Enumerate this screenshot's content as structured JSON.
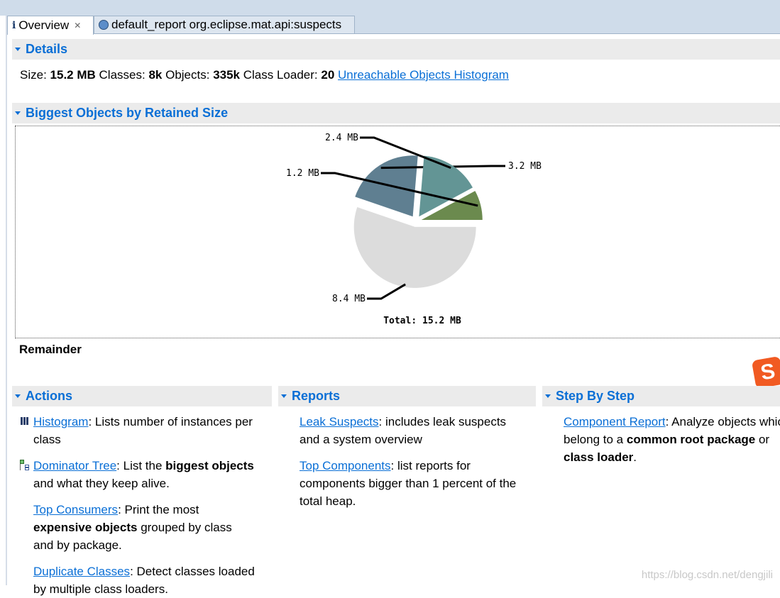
{
  "tabs": [
    {
      "label": "Overview",
      "icon": "info-icon",
      "active": true
    },
    {
      "label": "default_report  org.eclipse.mat.api:suspects",
      "icon": "report-icon",
      "active": false
    }
  ],
  "details": {
    "title": "Details",
    "size_label": "Size:",
    "size": "15.2 MB",
    "classes_label": "Classes:",
    "classes": "8k",
    "objects_label": "Objects:",
    "objects": "335k",
    "loader_label": "Class Loader:",
    "loader": "20",
    "link": "Unreachable Objects Histogram"
  },
  "biggest": {
    "title": "Biggest Objects by Retained Size",
    "remainder": "Remainder"
  },
  "chart_data": {
    "type": "pie",
    "values": [
      3.2,
      2.4,
      1.2,
      8.4
    ],
    "labels": [
      "3.2 MB",
      "2.4 MB",
      "1.2 MB",
      "8.4 MB"
    ],
    "colors": [
      "#5f7f91",
      "#639595",
      "#6b8a4e",
      "#dcdcdc"
    ],
    "total_label": "Total: 15.2 MB",
    "exploded": true
  },
  "actions": {
    "title": "Actions",
    "items": [
      {
        "link": "Histogram",
        "icon": "histogram-icon",
        "parts": [
          ": Lists number of instances per class"
        ]
      },
      {
        "link": "Dominator Tree",
        "icon": "dominator-tree-icon",
        "pre": ": List the ",
        "bold": "biggest objects",
        "post": " and what they keep alive."
      },
      {
        "link": "Top Consumers",
        "pre": ": Print the most ",
        "bold": "expensive objects",
        "post": " grouped by class and by package."
      },
      {
        "link": "Duplicate Classes",
        "pre": ": Detect classes loaded by multiple class loaders."
      }
    ]
  },
  "reports": {
    "title": "Reports",
    "items": [
      {
        "link": "Leak Suspects",
        "text": ": includes leak suspects and a system overview"
      },
      {
        "link": "Top Components",
        "text": ": list reports for components bigger than 1 percent of the total heap."
      }
    ]
  },
  "step": {
    "title": "Step By Step",
    "link": "Component Report",
    "pre": ": Analyze objects which belong to a ",
    "bold1": "common root package",
    "mid": " or ",
    "bold2": "class loader",
    "post": "."
  },
  "watermark": "https://blog.csdn.net/dengjili",
  "colors": {
    "accent": "#0a6fd6",
    "section_bg": "#ebebeb",
    "tab_bg": "#cfdcea"
  }
}
